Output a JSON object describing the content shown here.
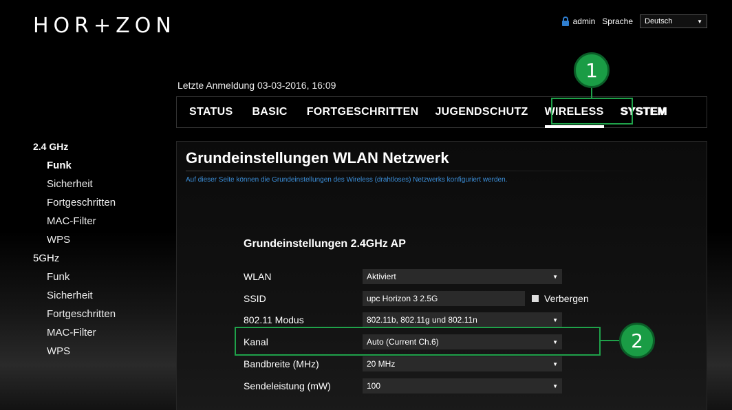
{
  "header": {
    "logo": "HOR+ZON",
    "user": "admin",
    "language_label": "Sprache",
    "language_value": "Deutsch",
    "last_login": "Letzte Anmeldung 03-03-2016, 16:09"
  },
  "nav": {
    "tabs": [
      {
        "label": "STATUS"
      },
      {
        "label": "BASIC"
      },
      {
        "label": "FORTGESCHRITTEN"
      },
      {
        "label": "JUGENDSCHUTZ"
      },
      {
        "label": "WIRELESS"
      },
      {
        "label": "SYSTEM"
      }
    ]
  },
  "sidebar": {
    "group1": "2.4 GHz",
    "group1_items": [
      "Funk",
      "Sicherheit",
      "Fortgeschritten",
      "MAC-Filter",
      "WPS"
    ],
    "group2": "5GHz",
    "group2_items": [
      "Funk",
      "Sicherheit",
      "Fortgeschritten",
      "MAC-Filter",
      "WPS"
    ]
  },
  "panel": {
    "title": "Grundeinstellungen WLAN Netzwerk",
    "description": "Auf dieser Seite können die Grundeinstellungen des Wireless (drahtloses) Netzwerks konfiguriert werden.",
    "section_title": "Grundeinstellungen 2.4GHz AP",
    "fields": {
      "wlan": {
        "label": "WLAN",
        "value": "Aktiviert"
      },
      "ssid": {
        "label": "SSID",
        "value": "upc Horizon 3 2.5G",
        "hide_label": "Verbergen"
      },
      "mode": {
        "label": "802.11 Modus",
        "value": "802.11b, 802.11g und 802.11n"
      },
      "channel": {
        "label": "Kanal",
        "value": "Auto (Current Ch.6)"
      },
      "bandwidth": {
        "label": "Bandbreite (MHz)",
        "value": "20 MHz"
      },
      "power": {
        "label": "Sendeleistung (mW)",
        "value": "100"
      }
    }
  },
  "annotations": {
    "badge1": "1",
    "badge2": "2",
    "color": "#1fa24a"
  }
}
